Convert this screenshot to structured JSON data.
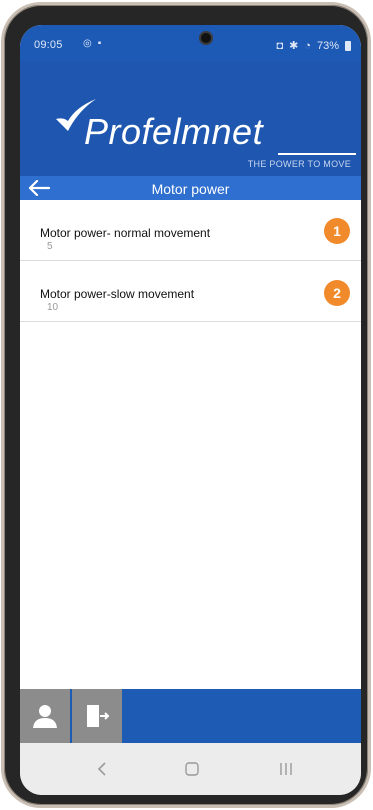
{
  "status_bar": {
    "time": "09:05",
    "battery": "73%"
  },
  "brand": {
    "logo_text": "Profelmnet",
    "tagline": "THE POWER TO MOVE"
  },
  "header": {
    "title": "Motor power"
  },
  "items": [
    {
      "title": "Motor power- normal movement",
      "value": "5",
      "badge": "1"
    },
    {
      "title": "Motor power-slow  movement",
      "value": "10",
      "badge": "2"
    }
  ],
  "colors": {
    "brand_blue": "#1e56b0",
    "titlebar_blue": "#2f6fcf",
    "badge_orange": "#f08a2a"
  },
  "icons": {
    "back": "arrow-left-icon",
    "user": "user-icon",
    "exit": "exit-door-icon"
  }
}
